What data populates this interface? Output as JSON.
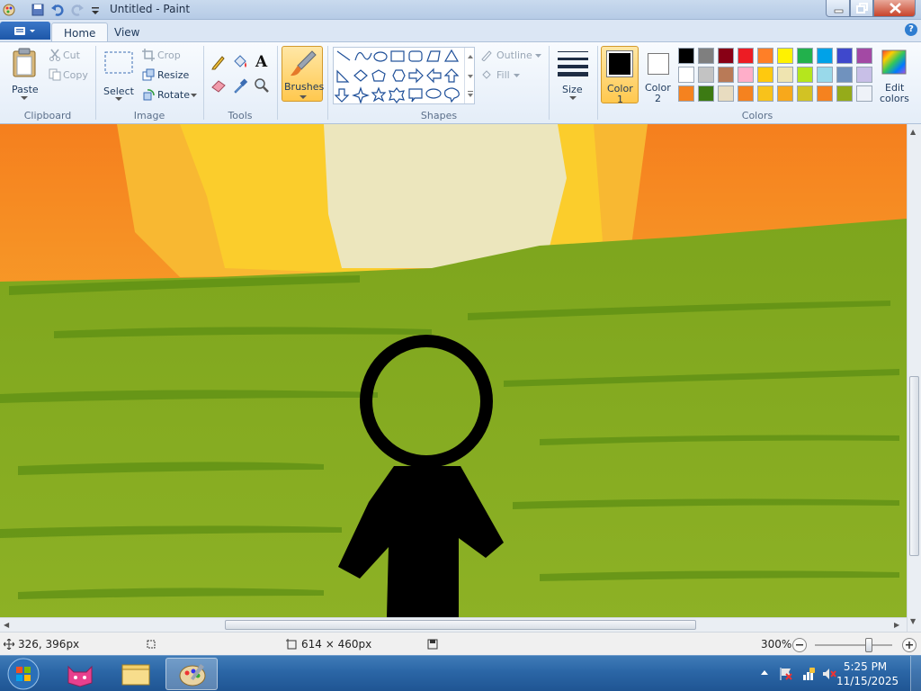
{
  "window": {
    "title": "Untitled - Paint"
  },
  "tabs": {
    "home": "Home",
    "view": "View"
  },
  "help": "?",
  "clipboard": {
    "paste": "Paste",
    "cut": "Cut",
    "copy": "Copy",
    "group": "Clipboard"
  },
  "image": {
    "select": "Select",
    "crop": "Crop",
    "resize": "Resize",
    "rotate": "Rotate",
    "group": "Image"
  },
  "tools": {
    "group": "Tools",
    "text_tool": "A"
  },
  "brushes": {
    "label": "Brushes"
  },
  "shapes": {
    "outline": "Outline",
    "fill": "Fill",
    "group": "Shapes"
  },
  "size": {
    "label": "Size"
  },
  "colors": {
    "color1_line1": "Color",
    "color1_line2": "1",
    "color2_line1": "Color",
    "color2_line2": "2",
    "group": "Colors",
    "edit_line1": "Edit",
    "edit_line2": "colors",
    "color1_value": "#000000",
    "color2_value": "#ffffff",
    "palette_row1": [
      "#000000",
      "#7f7f7f",
      "#880015",
      "#ed1c24",
      "#ff7f27",
      "#fff200",
      "#22b14c",
      "#00a2e8",
      "#3f48cc",
      "#a349a4"
    ],
    "palette_row2": [
      "#ffffff",
      "#c3c3c3",
      "#b97a57",
      "#ffaec9",
      "#ffc90e",
      "#efe4b0",
      "#b5e61d",
      "#99d9ea",
      "#7092be",
      "#c8bfe7"
    ],
    "palette_row3": [
      "#f5821f",
      "#3c7a13",
      "#e8dcc0",
      "#f5821f",
      "#f8c21b",
      "#f8a81b",
      "#d2c224",
      "#f5821f",
      "#95ab1a",
      "#eef2f8"
    ]
  },
  "status": {
    "cursor_pos": "326, 396px",
    "image_size": "614 × 460px",
    "zoom": "300%",
    "zoom_level_fraction": 0.7
  },
  "taskbar": {
    "time": "5:25 PM",
    "date": "11/15/2025"
  }
}
